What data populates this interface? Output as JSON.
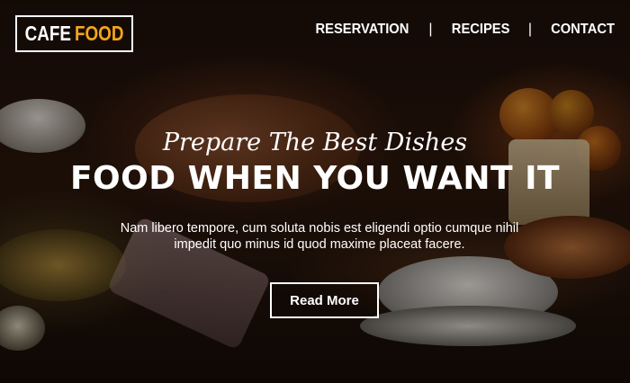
{
  "brand": {
    "word1": "CAFE",
    "word2": "FOOD"
  },
  "nav": {
    "items": [
      {
        "label": "RESERVATION"
      },
      {
        "label": "RECIPES"
      },
      {
        "label": "CONTACT"
      }
    ],
    "separator": "|"
  },
  "hero": {
    "subtitle": "Prepare The Best Dishes",
    "title": "FOOD WHEN YOU WANT IT",
    "description_line1": "Nam libero tempore, cum soluta nobis est eligendi optio cumque nihil",
    "description_line2": "impedit quo minus id quod maxime placeat facere.",
    "button_label": "Read More"
  },
  "colors": {
    "accent": "#f4a51c",
    "text": "#ffffff"
  }
}
